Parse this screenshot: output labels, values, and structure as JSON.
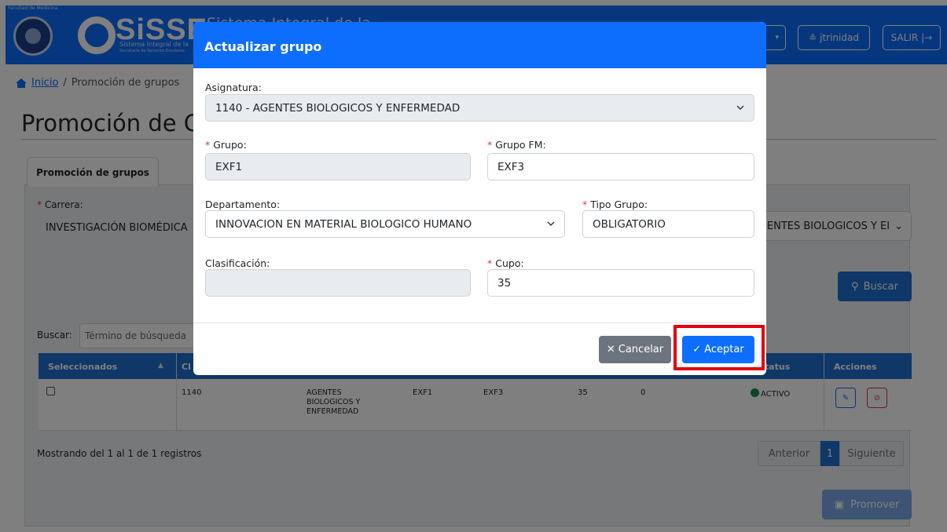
{
  "header": {
    "faculty": "Facultad de Medicina",
    "logo": "SiSSE",
    "logo_sub": "Sistema Integral de la",
    "logo_sub2": "Secretaría de Servicios Escolares",
    "system_title": "Sistema Integral de la",
    "user": "jtrinidad",
    "logout": "SALIR",
    "icons": {
      "user": "user-icon",
      "logout": "logout-icon",
      "dropdown": "chevron-down-icon"
    }
  },
  "breadcrumb": {
    "home": "Inicio",
    "separator": "/",
    "current": "Promoción de grupos"
  },
  "page_title": "Promoción de G",
  "tab": "Promoción de grupos",
  "filters": {
    "carrera_label": "Carrera:",
    "carrera_value": "INVESTIGACIÓN BIOMÉDICA",
    "asignatura_value": "GENTES BIOLOGICOS Y EI",
    "buscar": "Buscar"
  },
  "table": {
    "search_label": "Buscar:",
    "search_placeholder": "Término de búsqueda",
    "headers": {
      "seleccionados": "Seleccionados",
      "clave": "Cl",
      "status": "Status",
      "acciones": "Acciones"
    },
    "row": {
      "clave": "1140",
      "asignatura": "AGENTES BIOLOGICOS Y ENFERMEDAD",
      "grupo": "EXF1",
      "grupo_fm": "EXF3",
      "cupo": "35",
      "inscritos": "0",
      "status": "ACTIVO"
    },
    "showing": "Mostrando del 1 al 1 de 1 registros",
    "pager": {
      "prev": "Anterior",
      "page": "1",
      "next": "Siguiente"
    },
    "promover": "Promover"
  },
  "modal": {
    "title": "Actualizar grupo",
    "asignatura_label": "Asignatura:",
    "asignatura_value": "1140 - AGENTES BIOLOGICOS Y ENFERMEDAD",
    "grupo_label": "Grupo:",
    "grupo_value": "EXF1",
    "grupo_fm_label": "Grupo FM:",
    "grupo_fm_value": "EXF3",
    "departamento_label": "Departamento:",
    "departamento_value": "INNOVACION EN MATERIAL BIOLOGICO HUMANO",
    "tipo_grupo_label": "Tipo Grupo:",
    "tipo_grupo_value": "OBLIGATORIO",
    "clasificacion_label": "Clasificación:",
    "clasificacion_value": "",
    "cupo_label": "Cupo:",
    "cupo_value": "35",
    "cancel": "Cancelar",
    "accept": "Aceptar",
    "required_mark": "*"
  },
  "colors": {
    "primary": "#0d6efd",
    "danger": "#dc3545",
    "secondary": "#6c757d",
    "highlight": "#e3000f",
    "success": "#198754"
  }
}
